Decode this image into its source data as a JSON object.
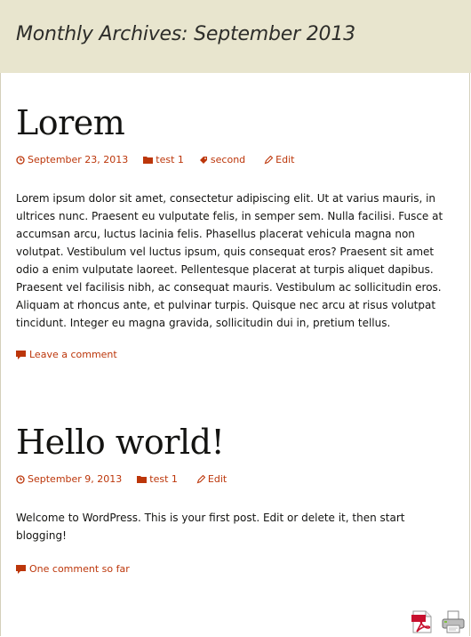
{
  "archive": {
    "title": "Monthly Archives: September 2013"
  },
  "posts": [
    {
      "title": "Lorem",
      "date": "September 23, 2013",
      "category": "test 1",
      "tag": "second",
      "edit": "Edit",
      "content": "Lorem ipsum dolor sit amet, consectetur adipiscing elit. Ut at varius mauris, in ultrices nunc. Praesent eu vulputate felis, in semper sem. Nulla facilisi. Fusce at accumsan arcu, luctus lacinia felis. Phasellus placerat vehicula magna non volutpat. Vestibulum vel luctus ipsum, quis consequat eros? Praesent sit amet odio a enim vulputate laoreet. Pellentesque placerat at turpis aliquet dapibus. Praesent vel facilisis nibh, ac consequat mauris. Vestibulum ac sollicitudin eros. Aliquam at rhoncus ante, et pulvinar turpis. Quisque nec arcu at risus volutpat tincidunt. Integer eu magna gravida, sollicitudin dui in, pretium tellus.",
      "comments": "Leave a comment"
    },
    {
      "title": "Hello world!",
      "date": "September 9, 2013",
      "category": "test 1",
      "edit": "Edit",
      "content": "Welcome to WordPress. This is your first post. Edit or delete it, then start blogging!",
      "comments": "One comment so far"
    }
  ],
  "footer_icons": {
    "pdf": "pdf-icon",
    "print": "printer-icon"
  },
  "colors": {
    "accent": "#bc360a",
    "header_bg": "#e8e5ce",
    "text": "#141412"
  }
}
